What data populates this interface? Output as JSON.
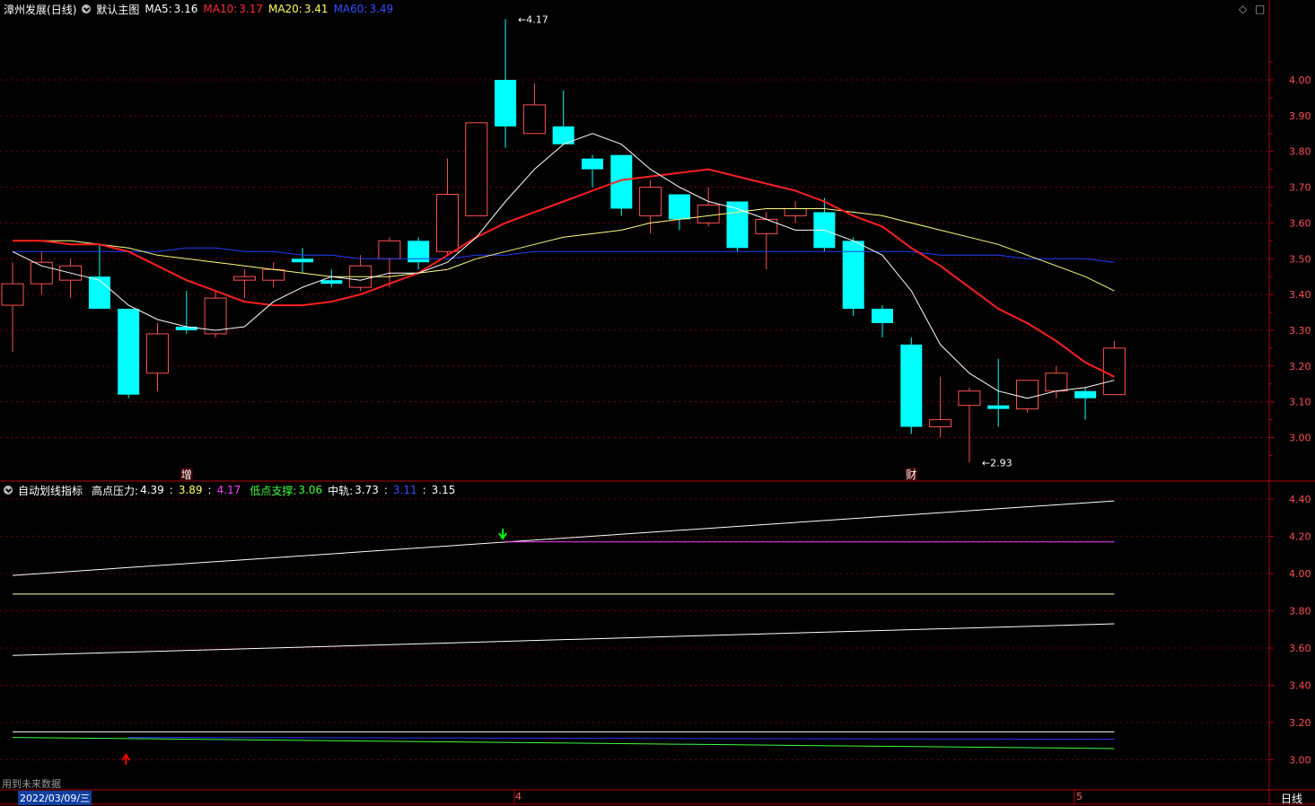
{
  "header": {
    "stock": "漳州发展",
    "period_tag": "(日线)",
    "main_chart": "默认主图",
    "ma5_label": "MA5:",
    "ma5": "3.16",
    "ma10_label": "MA10:",
    "ma10": "3.17",
    "ma20_label": "MA20:",
    "ma20": "3.41",
    "ma60_label": "MA60:",
    "ma60": "3.49"
  },
  "indicator_header": {
    "name": "自动划线指标",
    "high_label": "高点压力:",
    "high1": "4.39",
    "sep1": ":",
    "high2": "3.89",
    "sep2": ":",
    "high3": "4.17",
    "low_label": "低点支撑:",
    "low1": "3.06",
    "mid_label": "中轨:",
    "mid1": "3.73",
    "sep3": ":",
    "mid2": "3.11",
    "sep4": ":",
    "mid3": "3.15"
  },
  "footer": {
    "future_data_note": "用到未来数据",
    "date": "2022/03/09/三",
    "month_4": "4",
    "month_5": "5",
    "period_button": "日线"
  },
  "colors": {
    "up": "#ff5050",
    "down": "#00ffff",
    "ma5": "#ffffff",
    "ma10": "#ff2020",
    "ma20": "#ffff80",
    "ma60": "#2040ff",
    "grid": "#7a0000",
    "axis": "#b00000"
  },
  "chart_data": [
    {
      "type": "candlestick",
      "title": "漳州发展 (日线)",
      "ylim": [
        2.88,
        4.16
      ],
      "y_ticks": [
        "4.00",
        "3.90",
        "3.80",
        "3.70",
        "3.60",
        "3.50",
        "3.40",
        "3.30",
        "3.20",
        "3.10",
        "3.00"
      ],
      "y_tick_values": [
        4.0,
        3.9,
        3.8,
        3.7,
        3.6,
        3.5,
        3.4,
        3.3,
        3.2,
        3.1,
        3.0
      ],
      "candles": [
        {
          "o": 3.37,
          "h": 3.49,
          "l": 3.24,
          "c": 3.43
        },
        {
          "o": 3.43,
          "h": 3.52,
          "l": 3.4,
          "c": 3.49
        },
        {
          "o": 3.44,
          "h": 3.5,
          "l": 3.39,
          "c": 3.48
        },
        {
          "o": 3.45,
          "h": 3.54,
          "l": 3.36,
          "c": 3.36
        },
        {
          "o": 3.36,
          "h": 3.36,
          "l": 3.11,
          "c": 3.12
        },
        {
          "o": 3.18,
          "h": 3.32,
          "l": 3.13,
          "c": 3.29
        },
        {
          "o": 3.31,
          "h": 3.41,
          "l": 3.29,
          "c": 3.3
        },
        {
          "o": 3.29,
          "h": 3.41,
          "l": 3.28,
          "c": 3.39
        },
        {
          "o": 3.44,
          "h": 3.47,
          "l": 3.39,
          "c": 3.45
        },
        {
          "o": 3.44,
          "h": 3.49,
          "l": 3.42,
          "c": 3.47
        },
        {
          "o": 3.5,
          "h": 3.53,
          "l": 3.46,
          "c": 3.49
        },
        {
          "o": 3.44,
          "h": 3.47,
          "l": 3.42,
          "c": 3.43
        },
        {
          "o": 3.42,
          "h": 3.51,
          "l": 3.41,
          "c": 3.48
        },
        {
          "o": 3.5,
          "h": 3.56,
          "l": 3.42,
          "c": 3.55
        },
        {
          "o": 3.55,
          "h": 3.56,
          "l": 3.47,
          "c": 3.49
        },
        {
          "o": 3.52,
          "h": 3.78,
          "l": 3.51,
          "c": 3.68
        },
        {
          "o": 3.62,
          "h": 3.87,
          "l": 3.62,
          "c": 3.88
        },
        {
          "o": 4.0,
          "h": 4.17,
          "l": 3.81,
          "c": 3.87
        },
        {
          "o": 3.85,
          "h": 3.99,
          "l": 3.85,
          "c": 3.93
        },
        {
          "o": 3.87,
          "h": 3.97,
          "l": 3.83,
          "c": 3.82
        },
        {
          "o": 3.78,
          "h": 3.79,
          "l": 3.7,
          "c": 3.75
        },
        {
          "o": 3.79,
          "h": 3.79,
          "l": 3.62,
          "c": 3.64
        },
        {
          "o": 3.62,
          "h": 3.72,
          "l": 3.57,
          "c": 3.7
        },
        {
          "o": 3.68,
          "h": 3.68,
          "l": 3.58,
          "c": 3.61
        },
        {
          "o": 3.6,
          "h": 3.7,
          "l": 3.59,
          "c": 3.65
        },
        {
          "o": 3.66,
          "h": 3.66,
          "l": 3.52,
          "c": 3.53
        },
        {
          "o": 3.57,
          "h": 3.63,
          "l": 3.47,
          "c": 3.61
        },
        {
          "o": 3.62,
          "h": 3.66,
          "l": 3.6,
          "c": 3.64
        },
        {
          "o": 3.63,
          "h": 3.67,
          "l": 3.52,
          "c": 3.53
        },
        {
          "o": 3.55,
          "h": 3.56,
          "l": 3.34,
          "c": 3.36
        },
        {
          "o": 3.36,
          "h": 3.37,
          "l": 3.28,
          "c": 3.32
        },
        {
          "o": 3.26,
          "h": 3.28,
          "l": 3.01,
          "c": 3.03
        },
        {
          "o": 3.03,
          "h": 3.17,
          "l": 3.0,
          "c": 3.05
        },
        {
          "o": 3.09,
          "h": 3.14,
          "l": 2.93,
          "c": 3.13
        },
        {
          "o": 3.09,
          "h": 3.22,
          "l": 3.03,
          "c": 3.08
        },
        {
          "o": 3.08,
          "h": 3.16,
          "l": 3.07,
          "c": 3.16
        },
        {
          "o": 3.13,
          "h": 3.2,
          "l": 3.11,
          "c": 3.18
        },
        {
          "o": 3.13,
          "h": 3.14,
          "l": 3.05,
          "c": 3.11
        },
        {
          "o": 3.12,
          "h": 3.27,
          "l": 3.12,
          "c": 3.25
        }
      ],
      "ma5": [
        3.52,
        3.48,
        3.46,
        3.44,
        3.37,
        3.33,
        3.31,
        3.3,
        3.31,
        3.38,
        3.42,
        3.45,
        3.44,
        3.46,
        3.46,
        3.49,
        3.56,
        3.66,
        3.75,
        3.82,
        3.85,
        3.82,
        3.75,
        3.7,
        3.66,
        3.64,
        3.61,
        3.58,
        3.58,
        3.55,
        3.51,
        3.41,
        3.26,
        3.18,
        3.13,
        3.11,
        3.13,
        3.14,
        3.16
      ],
      "ma10": [
        3.55,
        3.55,
        3.54,
        3.54,
        3.52,
        3.48,
        3.44,
        3.41,
        3.38,
        3.37,
        3.37,
        3.38,
        3.4,
        3.43,
        3.46,
        3.51,
        3.56,
        3.6,
        3.63,
        3.66,
        3.69,
        3.72,
        3.73,
        3.74,
        3.75,
        3.73,
        3.71,
        3.69,
        3.66,
        3.62,
        3.59,
        3.53,
        3.48,
        3.42,
        3.36,
        3.32,
        3.27,
        3.21,
        3.17
      ],
      "ma20": [
        3.55,
        3.55,
        3.55,
        3.54,
        3.53,
        3.51,
        3.5,
        3.49,
        3.48,
        3.47,
        3.46,
        3.45,
        3.45,
        3.45,
        3.46,
        3.47,
        3.5,
        3.52,
        3.54,
        3.56,
        3.57,
        3.58,
        3.6,
        3.61,
        3.62,
        3.63,
        3.64,
        3.64,
        3.64,
        3.63,
        3.62,
        3.6,
        3.58,
        3.56,
        3.54,
        3.51,
        3.48,
        3.45,
        3.41
      ],
      "ma60": [
        3.52,
        3.52,
        3.52,
        3.52,
        3.52,
        3.52,
        3.53,
        3.53,
        3.52,
        3.52,
        3.51,
        3.51,
        3.5,
        3.5,
        3.5,
        3.5,
        3.51,
        3.51,
        3.52,
        3.52,
        3.52,
        3.52,
        3.52,
        3.52,
        3.52,
        3.52,
        3.52,
        3.52,
        3.52,
        3.52,
        3.52,
        3.52,
        3.51,
        3.51,
        3.51,
        3.5,
        3.5,
        3.5,
        3.49
      ],
      "annotations": [
        {
          "label": "4.17",
          "index": 17,
          "value": 4.17
        },
        {
          "label": "2.93",
          "index": 33,
          "value": 2.93
        }
      ],
      "markers": [
        {
          "label": "增",
          "index": 6
        },
        {
          "label": "财",
          "index": 31
        }
      ]
    },
    {
      "type": "line",
      "title": "自动划线指标",
      "ylim": [
        2.95,
        4.48
      ],
      "y_ticks": [
        "4.40",
        "4.20",
        "4.00",
        "3.80",
        "3.60",
        "3.40",
        "3.20",
        "3.00"
      ],
      "y_tick_values": [
        4.4,
        4.2,
        4.0,
        3.8,
        3.6,
        3.4,
        3.2,
        3.0
      ],
      "lines": [
        {
          "name": "高点压力",
          "color": "#ffffff",
          "x": [
            0,
            38
          ],
          "y": [
            3.99,
            4.39
          ]
        },
        {
          "name": "高点压力",
          "color": "#ff40ff",
          "x": [
            17,
            38
          ],
          "y": [
            4.17,
            4.17
          ]
        },
        {
          "name": "高点压力",
          "color": "#ffffb0",
          "x": [
            0,
            38
          ],
          "y": [
            3.89,
            3.89
          ]
        },
        {
          "name": "中轨",
          "color": "#ffffff",
          "x": [
            0,
            38
          ],
          "y": [
            3.56,
            3.73
          ]
        },
        {
          "name": "中轨",
          "color": "#ffffff",
          "x": [
            0,
            38
          ],
          "y": [
            3.15,
            3.15
          ]
        },
        {
          "name": "中轨",
          "color": "#3030ff",
          "x": [
            4,
            38
          ],
          "y": [
            3.12,
            3.11
          ]
        },
        {
          "name": "低点支撑",
          "color": "#40ff40",
          "x": [
            0,
            38
          ],
          "y": [
            3.12,
            3.06
          ]
        }
      ],
      "arrows": [
        {
          "dir": "down",
          "index": 17,
          "color": "#00ff00"
        },
        {
          "dir": "up",
          "index": 4,
          "color": "#ff0000"
        }
      ]
    }
  ]
}
